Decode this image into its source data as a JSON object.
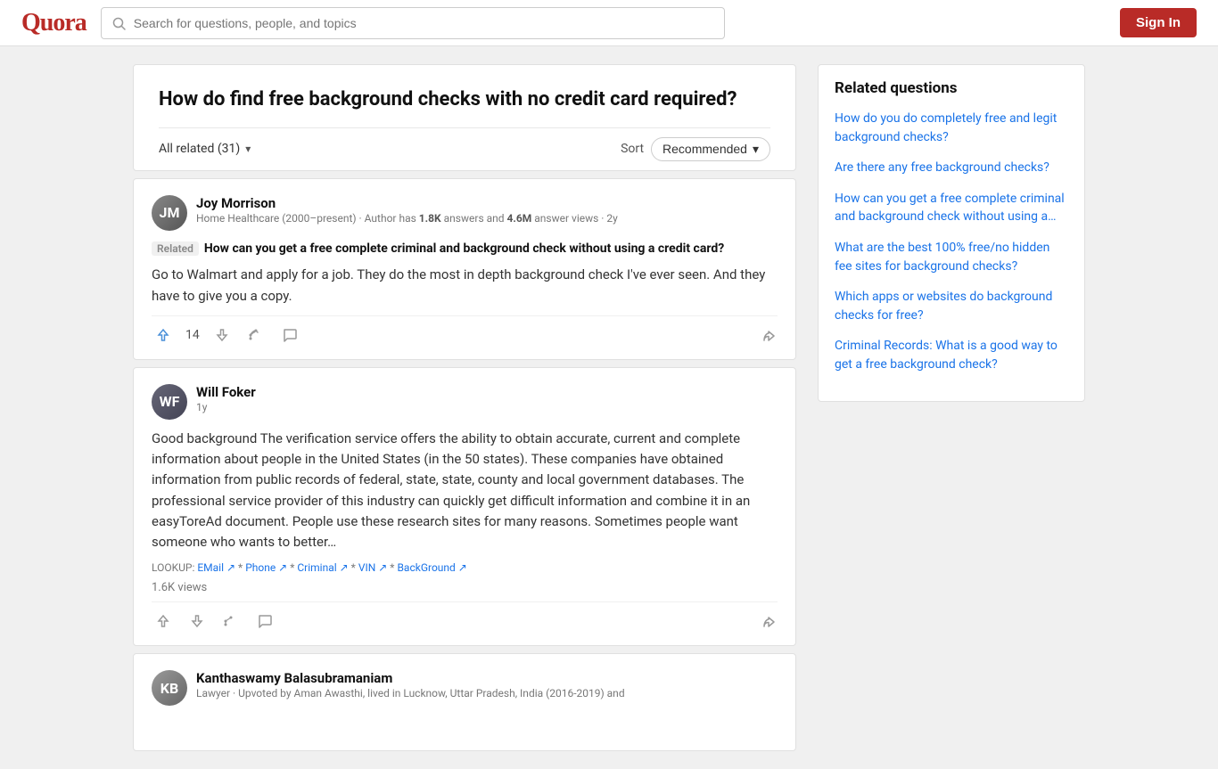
{
  "header": {
    "logo": "Quora",
    "search_placeholder": "Search for questions, people, and topics",
    "sign_in_label": "Sign In"
  },
  "question": {
    "title": "How do find free background checks with no credit card required?"
  },
  "toolbar": {
    "all_related": "All related (31)",
    "sort_label": "Sort",
    "recommended_label": "Recommended"
  },
  "answers": [
    {
      "id": "joy",
      "author": "Joy Morrison",
      "author_meta": "Home Healthcare (2000–present) · Author has ",
      "answers_count": "1.8K",
      "answers_suffix": " answers and ",
      "views_count": "4.6M",
      "views_suffix": " answer views · 2y",
      "related_label": "Related",
      "related_question": "How can you get a free complete criminal and background check without using a credit card?",
      "body": "Go to Walmart and apply for a job. They do the most in depth background check I've ever seen. And they have to give you a copy.",
      "upvotes": "14",
      "has_lookup": false,
      "answer_views": null
    },
    {
      "id": "will",
      "author": "Will Foker",
      "author_meta": "1y",
      "related_label": null,
      "related_question": null,
      "body": "Good background The verification service offers the ability to obtain accurate, current and complete information about people in the United States (in the 50 states). These companies have obtained information from public records of federal, state, state, county and local government databases. The professional service provider of this industry can quickly get difficult information and combine it in an easyToreAd document. People use these research sites for many reasons. Sometimes people want someone who wants to better…",
      "lookup_prefix": "LOOKUP: ",
      "lookup_links": [
        "EMail",
        "Phone",
        "Criminal",
        "VIN",
        "BackGround"
      ],
      "upvotes": null,
      "answer_views": "1.6K views"
    },
    {
      "id": "kant",
      "author": "Kanthaswamy Balasubramaniam",
      "author_meta": "Lawyer · Upvoted by Aman Awasthi, lived in Lucknow, Uttar Pradesh, India (2016-2019) and",
      "body": "",
      "upvotes": null,
      "answer_views": null
    }
  ],
  "related_questions": {
    "title": "Related questions",
    "items": [
      "How do you do completely free and legit background checks?",
      "Are there any free background checks?",
      "How can you get a free complete criminal and background check without using a…",
      "What are the best 100% free/no hidden fee sites for background checks?",
      "Which apps or websites do background checks for free?",
      "Criminal Records: What is a good way to get a free background check?"
    ]
  }
}
